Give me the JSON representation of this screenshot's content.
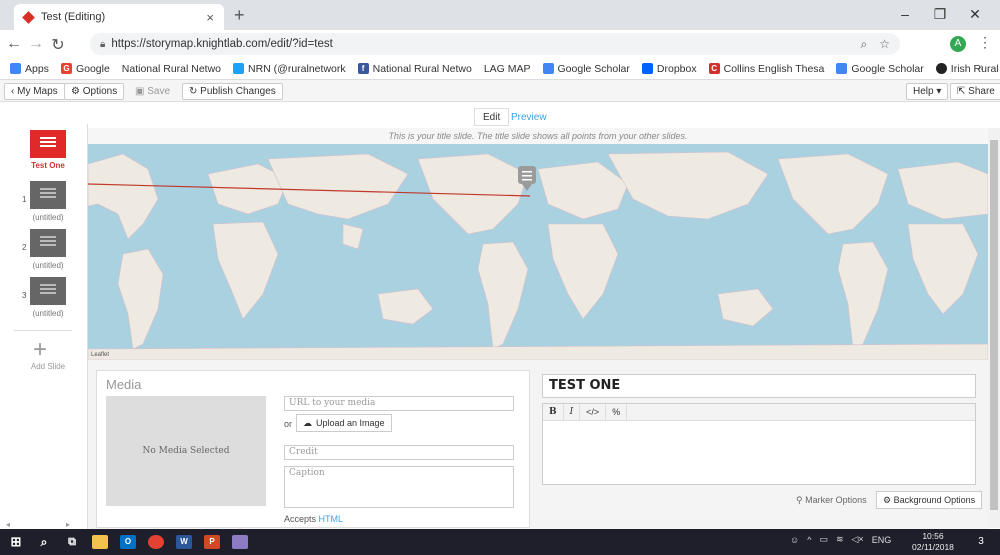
{
  "browser": {
    "tab_title": "Test (Editing)",
    "url": "https://storymap.knightlab.com/edit/?id=test",
    "avatar_letter": "A"
  },
  "bookmarks": [
    {
      "label": "Apps",
      "color": "#4285f4"
    },
    {
      "label": "Google",
      "color": "#ea4335"
    },
    {
      "label": "National Rural Netwo",
      "color": ""
    },
    {
      "label": "NRN (@ruralnetwork",
      "color": "#1da1f2"
    },
    {
      "label": "National Rural Netwo",
      "color": "#3b5998"
    },
    {
      "label": "LAG MAP",
      "color": ""
    },
    {
      "label": "Google Scholar",
      "color": "#4285f4"
    },
    {
      "label": "Dropbox",
      "color": "#0061ff"
    },
    {
      "label": "Collins English Thesa",
      "color": "#d32f2f"
    },
    {
      "label": "Google Scholar",
      "color": "#4285f4"
    },
    {
      "label": "Irish Rural Link",
      "color": "#222222"
    }
  ],
  "toolbar": {
    "my_maps": "My Maps",
    "options": "Options",
    "save": "Save",
    "publish": "Publish Changes",
    "help": "Help",
    "share": "Share"
  },
  "mode": {
    "edit": "Edit",
    "preview": "Preview"
  },
  "sidebar": {
    "title_slide_label": "Test One",
    "slides": [
      {
        "number": "1",
        "label": "(untitled)"
      },
      {
        "number": "2",
        "label": "(untitled)"
      },
      {
        "number": "3",
        "label": "(untitled)"
      }
    ],
    "add_slide": "Add Slide"
  },
  "map": {
    "title_hint": "This is your title slide. The title slide shows all points from your other slides.",
    "attribution": "Leaflet"
  },
  "media": {
    "header": "Media",
    "no_media": "No Media Selected",
    "url_placeholder": "URL to your media",
    "or": "or",
    "upload": "Upload an Image",
    "credit_placeholder": "Credit",
    "caption_placeholder": "Caption",
    "accepts": "Accepts",
    "accepts_link": "HTML"
  },
  "slide_text": {
    "headline": "TEST ONE",
    "tools": [
      "B",
      "I",
      "</>",
      "%"
    ],
    "marker_options": "Marker Options",
    "background_options": "Background Options"
  },
  "taskbar": {
    "lang": "ENG",
    "time": "10:56",
    "date": "02/11/2018",
    "notifications": "3"
  }
}
